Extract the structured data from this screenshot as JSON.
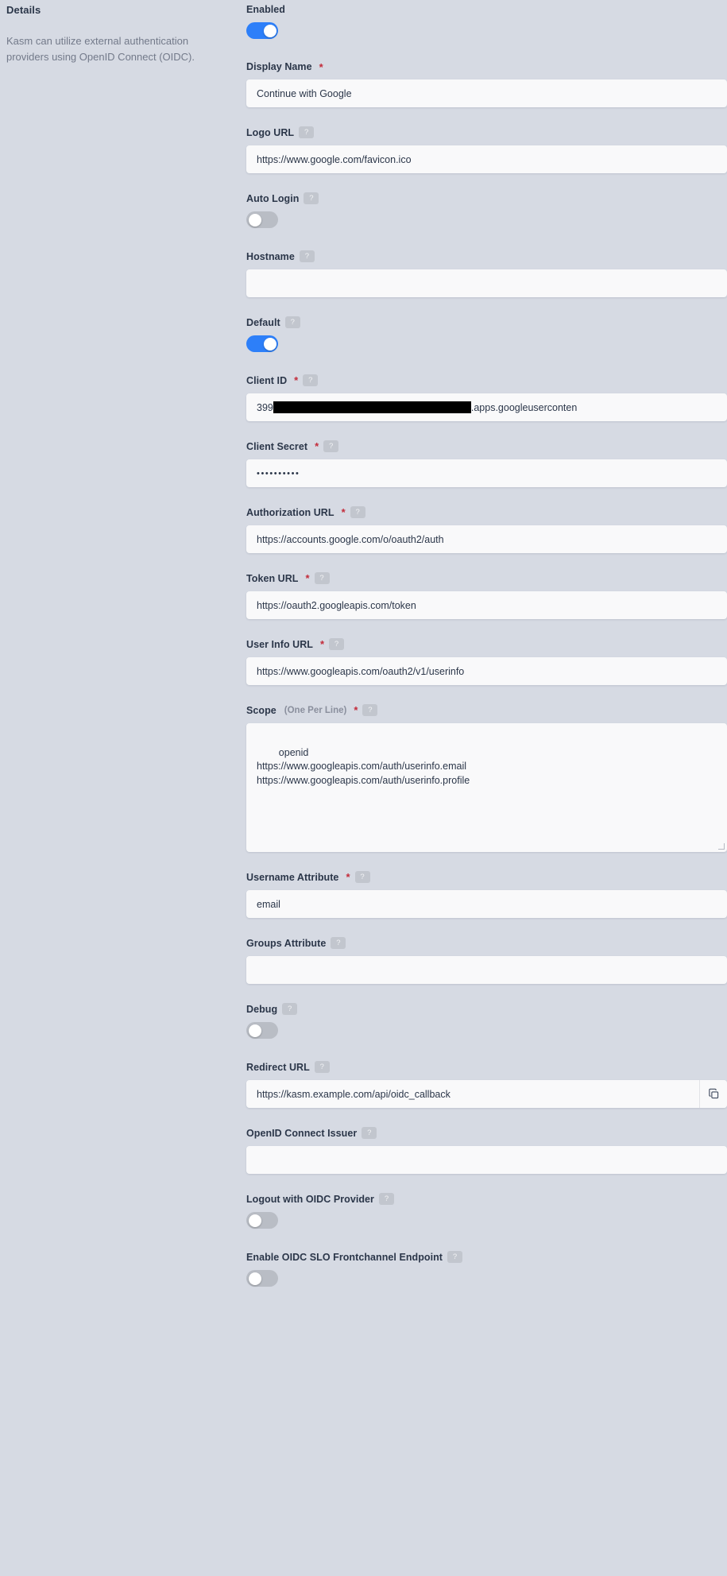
{
  "details": {
    "heading": "Details",
    "description": "Kasm can utilize external authentication providers using OpenID Connect (OIDC)."
  },
  "help_badge_glyph": "?",
  "required_marker": "*",
  "colors": {
    "page_background": "#d6dae3",
    "input_background": "#f9f9fa",
    "label_text": "#2b3649",
    "muted_text": "#737a8a",
    "required_red": "#c32b3a",
    "toggle_on": "#2d7ff9",
    "toggle_off": "#b9bdc5",
    "redaction": "#000000"
  },
  "form": {
    "enabled": {
      "label": "Enabled",
      "type": "toggle",
      "state": "on",
      "required": false,
      "has_help": false
    },
    "display_name": {
      "label": "Display Name",
      "type": "text",
      "value": "Continue with Google",
      "required": true,
      "has_help": false
    },
    "logo_url": {
      "label": "Logo URL",
      "type": "text",
      "value": "https://www.google.com/favicon.ico",
      "required": false,
      "has_help": true
    },
    "auto_login": {
      "label": "Auto Login",
      "type": "toggle",
      "state": "off",
      "required": false,
      "has_help": true
    },
    "hostname": {
      "label": "Hostname",
      "type": "text",
      "value": "",
      "required": false,
      "has_help": true
    },
    "default": {
      "label": "Default",
      "type": "toggle",
      "state": "on",
      "required": false,
      "has_help": true
    },
    "client_id": {
      "label": "Client ID",
      "type": "text-redacted",
      "value_prefix": "399",
      "value_suffix": ".apps.googleuserconten",
      "required": true,
      "has_help": true
    },
    "client_secret": {
      "label": "Client Secret",
      "type": "password",
      "value": "••••••••••",
      "required": true,
      "has_help": true
    },
    "authorization_url": {
      "label": "Authorization URL",
      "type": "text",
      "value": "https://accounts.google.com/o/oauth2/auth",
      "required": true,
      "has_help": true
    },
    "token_url": {
      "label": "Token URL",
      "type": "text",
      "value": "https://oauth2.googleapis.com/token",
      "required": true,
      "has_help": true
    },
    "user_info_url": {
      "label": "User Info URL",
      "type": "text",
      "value": "https://www.googleapis.com/oauth2/v1/userinfo",
      "required": true,
      "has_help": true
    },
    "scope": {
      "label": "Scope",
      "label_sub": "(One Per Line)",
      "type": "textarea",
      "value": "openid\nhttps://www.googleapis.com/auth/userinfo.email\nhttps://www.googleapis.com/auth/userinfo.profile",
      "required": true,
      "has_help": true
    },
    "username_attribute": {
      "label": "Username Attribute",
      "type": "text",
      "value": "email",
      "required": true,
      "has_help": true
    },
    "groups_attribute": {
      "label": "Groups Attribute",
      "type": "text",
      "value": "",
      "required": false,
      "has_help": true
    },
    "debug": {
      "label": "Debug",
      "type": "toggle",
      "state": "off",
      "required": false,
      "has_help": true
    },
    "redirect_url": {
      "label": "Redirect URL",
      "type": "text-copy",
      "value": "https://kasm.example.com/api/oidc_callback",
      "required": false,
      "has_help": true,
      "copy_icon": "copy-icon"
    },
    "openid_connect_issuer": {
      "label": "OpenID Connect Issuer",
      "type": "text",
      "value": "",
      "required": false,
      "has_help": true
    },
    "logout_with_oidc_provider": {
      "label": "Logout with OIDC Provider",
      "type": "toggle",
      "state": "off",
      "required": false,
      "has_help": true
    },
    "enable_oidc_slo_frontchannel_endpoint": {
      "label": "Enable OIDC SLO Frontchannel Endpoint",
      "type": "toggle",
      "state": "off",
      "required": false,
      "has_help": true
    }
  }
}
